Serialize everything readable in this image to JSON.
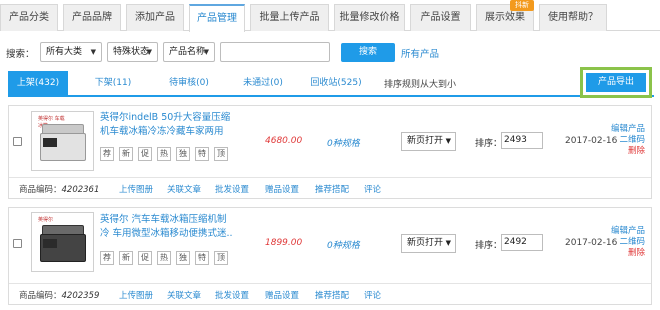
{
  "tabs": [
    {
      "label": "产品分类"
    },
    {
      "label": "产品品牌"
    },
    {
      "label": "添加产品"
    },
    {
      "label": "产品管理"
    },
    {
      "label": "批量上传产品"
    },
    {
      "label": "批量修改价格"
    },
    {
      "label": "产品设置"
    },
    {
      "label": "展示效果"
    },
    {
      "label": "使用帮助？"
    }
  ],
  "tab_badge": "抖新",
  "search": {
    "label": "搜索：",
    "category": "所有大类",
    "status": "特殊状态",
    "field": "产品名称",
    "input_value": "",
    "button": "搜索",
    "all_link": "所有产品"
  },
  "subtabs": [
    {
      "label": "上架(432)"
    },
    {
      "label": "下架(11)"
    },
    {
      "label": "待审核(0)"
    },
    {
      "label": "未通过(0)"
    },
    {
      "label": "回收站(525)"
    }
  ],
  "sort_text": "排序规则从大到小",
  "export_button": "产品导出",
  "flags": [
    "荐",
    "新",
    "促",
    "热",
    "独",
    "特",
    "顶"
  ],
  "products": [
    {
      "title": "英得尔indelB 50升大容量压缩机车载冰箱冷冻冷藏车家两用",
      "brand_text": "英得尔 车载冰箱",
      "price": "4680.00",
      "spec": "0种规格",
      "open_mode": "新页打开",
      "order_label": "排序：",
      "order": "2493",
      "date": "2017-02-16",
      "actions": [
        "编辑产品",
        "二维码",
        "删除"
      ],
      "code_label": "商品编码：",
      "code": "4202361",
      "links": [
        "上传图册",
        "关联文章",
        "批发设置",
        "赠品设置",
        "推荐搭配",
        "评论"
      ]
    },
    {
      "title": "英得尔 汽车车载冰箱压缩机制冷 车用微型冰箱移动便携式迷..",
      "brand_text": "英得尔",
      "price": "1899.00",
      "spec": "0种规格",
      "open_mode": "新页打开",
      "order_label": "排序：",
      "order": "2492",
      "date": "2017-02-16",
      "actions": [
        "编辑产品",
        "二维码",
        "删除"
      ],
      "code_label": "商品编码：",
      "code": "4202359",
      "links": [
        "上传图册",
        "关联文章",
        "批发设置",
        "赠品设置",
        "推荐搭配",
        "评论"
      ]
    }
  ],
  "colors": {
    "accent": "#1f9be8",
    "price": "#e03a3a",
    "highlight_border": "#8bc34a"
  }
}
